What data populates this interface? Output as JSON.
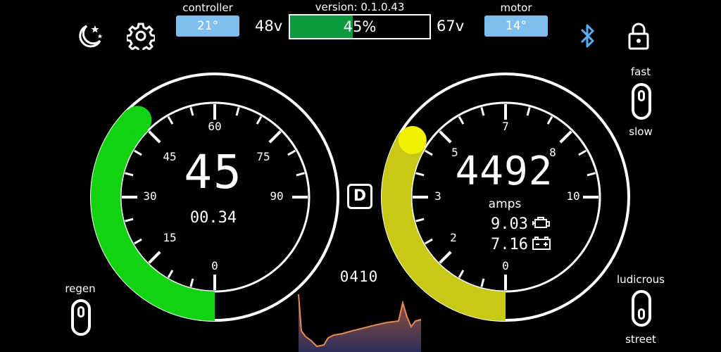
{
  "top_bar": {
    "controller_label": "controller",
    "controller_temp": "21°",
    "version": "version: 0.1.0.43",
    "voltage_min": "48v",
    "voltage_max": "67v",
    "battery_percent_text": "45%",
    "battery_fraction": 0.45,
    "motor_label": "motor",
    "motor_temp": "14°"
  },
  "icons": {
    "night_mode": "moon-stars-icon",
    "settings": "gear-icon",
    "bluetooth": "bluetooth-icon",
    "lock": "lock-icon",
    "engine": "engine-icon",
    "battery": "battery-icon"
  },
  "colors": {
    "speed_arc": "#12d212",
    "rpm_arc": "#c8c816",
    "battery_fill": "#0c9a3c",
    "temp_box": "#7fbff0",
    "bluetooth": "#59aef0",
    "graph_line": "#e58a55"
  },
  "speed_gauge": {
    "value": "45",
    "trip": "00.34",
    "ticks": [
      "0",
      "15",
      "30",
      "45",
      "60",
      "75",
      "90"
    ],
    "level_fraction": 0.5
  },
  "rpm_gauge": {
    "value": "4492",
    "unit_label": "amps",
    "motor_amps": "9.03",
    "battery_amps": "7.16",
    "ticks": [
      "0",
      "2",
      "3",
      "5",
      "7",
      "8",
      "10"
    ],
    "level_fraction": 0.45
  },
  "gear": "D",
  "graph_value": "0410",
  "toggles": {
    "mode_top": "fast",
    "mode_bottom": "slow",
    "regen_label": "regen",
    "profile_top": "ludicrous",
    "profile_bottom": "street"
  }
}
